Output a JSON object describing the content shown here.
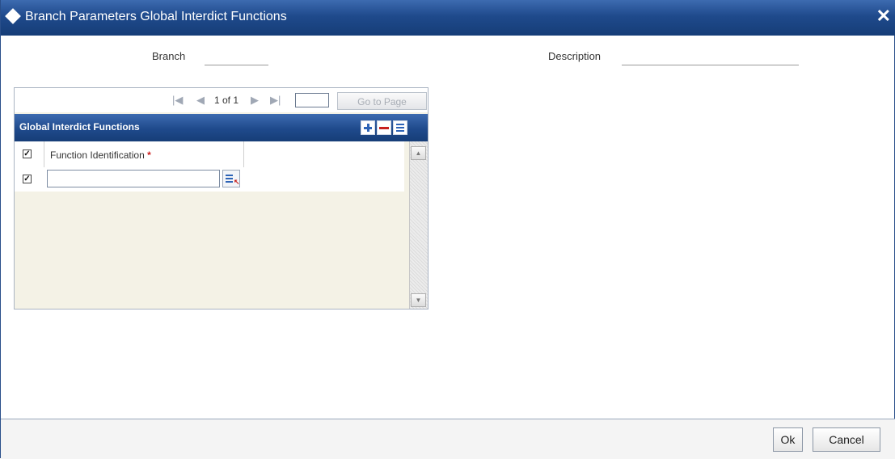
{
  "window": {
    "title": "Branch Parameters Global Interdict Functions",
    "close_symbol": "✕"
  },
  "form": {
    "branch_label": "Branch",
    "branch_value": "",
    "description_label": "Description",
    "description_value": ""
  },
  "pager": {
    "page_text": "1 of 1",
    "page_input": "",
    "goto_label": "Go to Page"
  },
  "grid": {
    "title": "Global Interdict Functions",
    "header_checked": true,
    "columns": [
      {
        "label": "Function Identification",
        "required": true,
        "required_mark": "*"
      }
    ],
    "rows": [
      {
        "checked": true,
        "function_id": ""
      }
    ]
  },
  "footer": {
    "ok_label": "Ok",
    "cancel_label": "Cancel"
  },
  "colors": {
    "header_blue": "#1f4a8c",
    "required_red": "#cc1f1f",
    "grid_bg": "#f4f2e6"
  }
}
